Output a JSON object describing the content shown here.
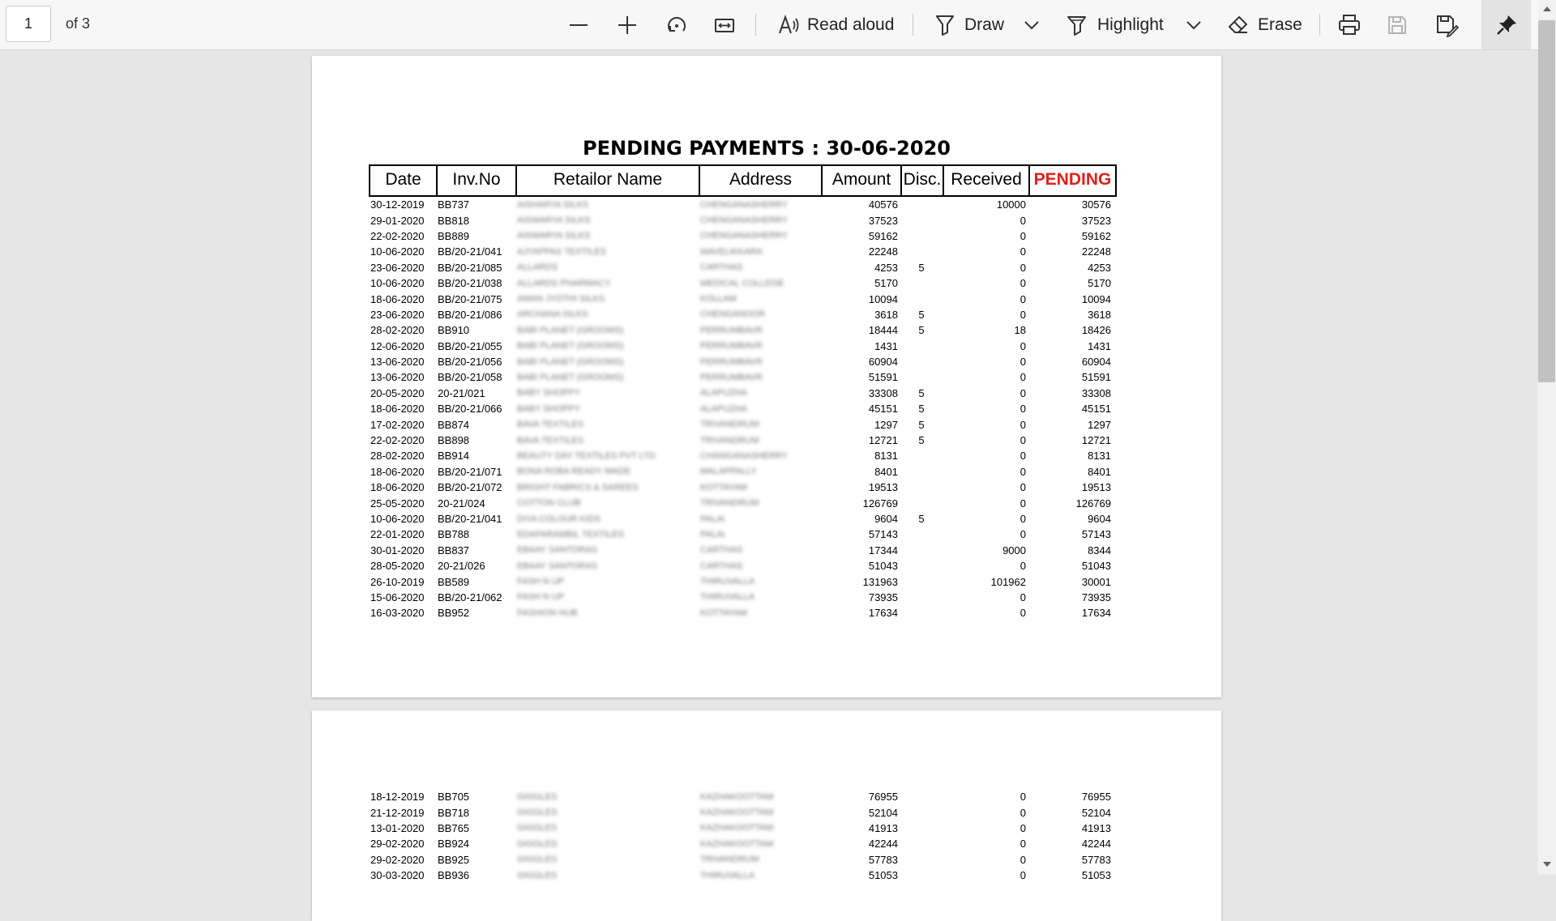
{
  "toolbar": {
    "page_number": "1",
    "page_count": "of 3",
    "read_aloud": "Read aloud",
    "draw": "Draw",
    "highlight": "Highlight",
    "erase": "Erase"
  },
  "report": {
    "title": "PENDING PAYMENTS : 30-06-2020",
    "headers": {
      "date": "Date",
      "inv": "Inv.No",
      "retailer": "Retailor Name",
      "address": "Address",
      "amount": "Amount",
      "disc": "Disc.",
      "received": "Received",
      "pending": "PENDING"
    },
    "pending_color": "#e0201a"
  },
  "page1_rows": [
    {
      "date": "30-12-2019",
      "inv": "BB737",
      "retailer": "AISHARYA SILKS",
      "address": "CHENGANASHERRY",
      "amount": "40576",
      "disc": "",
      "received": "10000",
      "pending": "30576"
    },
    {
      "date": "29-01-2020",
      "inv": "BB818",
      "retailer": "AISWARYA SILKS",
      "address": "CHENGANASHERRY",
      "amount": "37523",
      "disc": "",
      "received": "0",
      "pending": "37523"
    },
    {
      "date": "22-02-2020",
      "inv": "BB889",
      "retailer": "AISWARYA SILKS",
      "address": "CHENGANASHERRY",
      "amount": "59162",
      "disc": "",
      "received": "0",
      "pending": "59162"
    },
    {
      "date": "10-06-2020",
      "inv": "BB/20-21/041",
      "retailer": "AJYAPPAS TEXTILES",
      "address": "MAVELIKKARA",
      "amount": "22248",
      "disc": "",
      "received": "0",
      "pending": "22248"
    },
    {
      "date": "23-06-2020",
      "inv": "BB/20-21/085",
      "retailer": "ALLARDS",
      "address": "CARTHAS",
      "amount": "4253",
      "disc": "5",
      "received": "0",
      "pending": "4253"
    },
    {
      "date": "10-06-2020",
      "inv": "BB/20-21/038",
      "retailer": "ALLARDS PHARMACY",
      "address": "MEDICAL COLLEGE",
      "amount": "5170",
      "disc": "",
      "received": "0",
      "pending": "5170"
    },
    {
      "date": "18-06-2020",
      "inv": "BB/20-21/075",
      "retailer": "AMAN JYOTHI SILKS",
      "address": "KOLLAM",
      "amount": "10094",
      "disc": "",
      "received": "0",
      "pending": "10094"
    },
    {
      "date": "23-06-2020",
      "inv": "BB/20-21/086",
      "retailer": "ARCHANA SILKS",
      "address": "CHENGANOOR",
      "amount": "3618",
      "disc": "5",
      "received": "0",
      "pending": "3618"
    },
    {
      "date": "28-02-2020",
      "inv": "BB910",
      "retailer": "BABI PLANET (GROOMS)",
      "address": "PERRUMBAVR",
      "amount": "18444",
      "disc": "5",
      "received": "18",
      "pending": "18426"
    },
    {
      "date": "12-06-2020",
      "inv": "BB/20-21/055",
      "retailer": "BABI PLANET (GROOMS)",
      "address": "PERRUMBAVR",
      "amount": "1431",
      "disc": "",
      "received": "0",
      "pending": "1431"
    },
    {
      "date": "13-06-2020",
      "inv": "BB/20-21/056",
      "retailer": "BABI PLANET (GROOMS)",
      "address": "PERRUMBAVR",
      "amount": "60904",
      "disc": "",
      "received": "0",
      "pending": "60904"
    },
    {
      "date": "13-06-2020",
      "inv": "BB/20-21/058",
      "retailer": "BABI PLANET (GROOMS)",
      "address": "PERRUMBAVR",
      "amount": "51591",
      "disc": "",
      "received": "0",
      "pending": "51591"
    },
    {
      "date": "20-05-2020",
      "inv": "20-21/021",
      "retailer": "BABY SHOPPY",
      "address": "ALAPUZHA",
      "amount": "33308",
      "disc": "5",
      "received": "0",
      "pending": "33308"
    },
    {
      "date": "18-06-2020",
      "inv": "BB/20-21/066",
      "retailer": "BABY SHOPPY",
      "address": "ALAPUZHA",
      "amount": "45151",
      "disc": "5",
      "received": "0",
      "pending": "45151"
    },
    {
      "date": "17-02-2020",
      "inv": "BB874",
      "retailer": "BAVA TEXTILES",
      "address": "TRIVANDRUM",
      "amount": "1297",
      "disc": "5",
      "received": "0",
      "pending": "1297"
    },
    {
      "date": "22-02-2020",
      "inv": "BB898",
      "retailer": "BAVA TEXTILES",
      "address": "TRIVANDRUM",
      "amount": "12721",
      "disc": "5",
      "received": "0",
      "pending": "12721"
    },
    {
      "date": "28-02-2020",
      "inv": "BB914",
      "retailer": "BEAUTY DAY TEXTILES PVT LTD",
      "address": "CHANGANASHERRY",
      "amount": "8131",
      "disc": "",
      "received": "0",
      "pending": "8131"
    },
    {
      "date": "18-06-2020",
      "inv": "BB/20-21/071",
      "retailer": "BONA ROBA READY MADE",
      "address": "MALAPPALLY",
      "amount": "8401",
      "disc": "",
      "received": "0",
      "pending": "8401"
    },
    {
      "date": "18-06-2020",
      "inv": "BB/20-21/072",
      "retailer": "BRIGHT FABRICS & SAREES",
      "address": "KOTTAYAM",
      "amount": "19513",
      "disc": "",
      "received": "0",
      "pending": "19513"
    },
    {
      "date": "25-05-2020",
      "inv": "20-21/024",
      "retailer": "COTTON CLUB",
      "address": "TRIVANDRUM",
      "amount": "126769",
      "disc": "",
      "received": "0",
      "pending": "126769"
    },
    {
      "date": "10-06-2020",
      "inv": "BB/20-21/041",
      "retailer": "DIYA COLOUR KIDS",
      "address": "PALAI",
      "amount": "9604",
      "disc": "5",
      "received": "0",
      "pending": "9604"
    },
    {
      "date": "22-01-2020",
      "inv": "BB788",
      "retailer": "EDAPARAMBIL TEXTILES",
      "address": "PALAI",
      "amount": "57143",
      "disc": "",
      "received": "0",
      "pending": "57143"
    },
    {
      "date": "30-01-2020",
      "inv": "BB837",
      "retailer": "EBAAY SANTORAS",
      "address": "CARTHAS",
      "amount": "17344",
      "disc": "",
      "received": "9000",
      "pending": "8344"
    },
    {
      "date": "28-05-2020",
      "inv": "20-21/026",
      "retailer": "EBAAY SANTORAS",
      "address": "CARTHAS",
      "amount": "51043",
      "disc": "",
      "received": "0",
      "pending": "51043"
    },
    {
      "date": "26-10-2019",
      "inv": "BB589",
      "retailer": "FASH N UP",
      "address": "THIRUVALLA",
      "amount": "131963",
      "disc": "",
      "received": "101962",
      "pending": "30001"
    },
    {
      "date": "15-06-2020",
      "inv": "BB/20-21/062",
      "retailer": "FASH N UP",
      "address": "THIRUVALLA",
      "amount": "73935",
      "disc": "",
      "received": "0",
      "pending": "73935"
    },
    {
      "date": "16-03-2020",
      "inv": "BB952",
      "retailer": "FASHION HUB",
      "address": "KOTTAYAM",
      "amount": "17634",
      "disc": "",
      "received": "0",
      "pending": "17634"
    }
  ],
  "page2_rows": [
    {
      "date": "18-12-2019",
      "inv": "BB705",
      "retailer": "GIGGLES",
      "address": "KAZHAKOOTTAM",
      "amount": "76955",
      "disc": "",
      "received": "0",
      "pending": "76955"
    },
    {
      "date": "21-12-2019",
      "inv": "BB718",
      "retailer": "GIGGLES",
      "address": "KAZHAKOOTTAM",
      "amount": "52104",
      "disc": "",
      "received": "0",
      "pending": "52104"
    },
    {
      "date": "13-01-2020",
      "inv": "BB765",
      "retailer": "GIGGLES",
      "address": "KAZHAKOOTTAM",
      "amount": "41913",
      "disc": "",
      "received": "0",
      "pending": "41913"
    },
    {
      "date": "29-02-2020",
      "inv": "BB924",
      "retailer": "GIGGLES",
      "address": "KAZHAKOOTTAM",
      "amount": "42244",
      "disc": "",
      "received": "0",
      "pending": "42244"
    },
    {
      "date": "29-02-2020",
      "inv": "BB925",
      "retailer": "GIGGLES",
      "address": "TRIVANDRUM",
      "amount": "57783",
      "disc": "",
      "received": "0",
      "pending": "57783"
    },
    {
      "date": "30-03-2020",
      "inv": "BB936",
      "retailer": "GIGGLES",
      "address": "THIRUVALLA",
      "amount": "51053",
      "disc": "",
      "received": "0",
      "pending": "51053"
    }
  ]
}
